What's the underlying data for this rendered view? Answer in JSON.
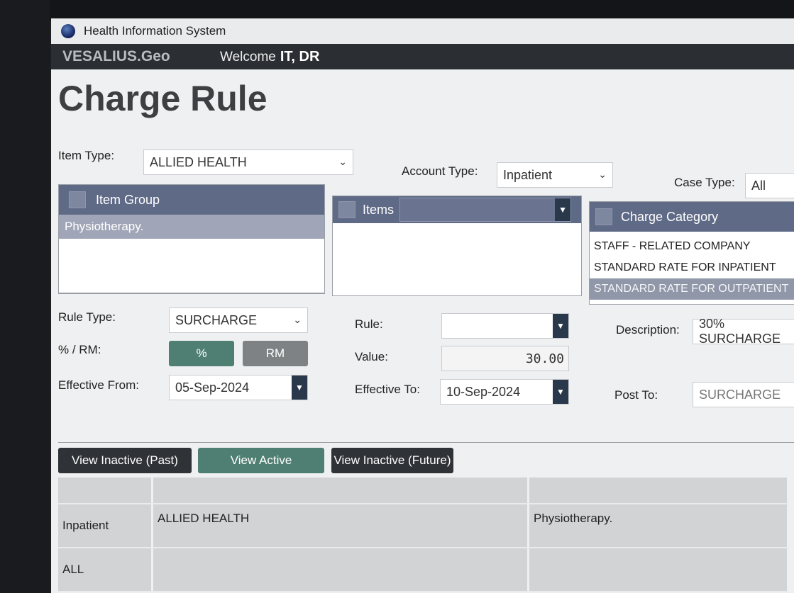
{
  "window": {
    "title": "Health Information System"
  },
  "appbar": {
    "brand": "VESALIUS.Geo",
    "welcome_label": "Welcome",
    "user": "IT, DR"
  },
  "page": {
    "title": "Charge Rule"
  },
  "filters": {
    "item_type_label": "Item Type:",
    "item_type_value": "ALLIED HEALTH",
    "account_type_label": "Account Type:",
    "account_type_value": "Inpatient",
    "case_type_label": "Case Type:",
    "case_type_value": "All"
  },
  "item_group": {
    "header": "Item Group",
    "rows": [
      "Physiotherapy."
    ]
  },
  "items": {
    "header": "Items",
    "filter_value": ""
  },
  "charge_category": {
    "header": "Charge Category",
    "rows": [
      "STAFF - RELATED COMPANY",
      "STANDARD RATE FOR INPATIENT",
      "STANDARD RATE FOR OUTPATIENT"
    ],
    "selected_index": 2
  },
  "form": {
    "rule_type_label": "Rule Type:",
    "rule_type_value": "SURCHARGE",
    "rule_label": "Rule:",
    "rule_value": "",
    "description_label": "Description:",
    "description_value": "30% SURCHARGE",
    "pct_rm_label": "% / RM:",
    "pct_button": "%",
    "rm_button": "RM",
    "value_label": "Value:",
    "value_value": "30.00",
    "effective_from_label": "Effective From:",
    "effective_from_value": "05-Sep-2024",
    "effective_to_label": "Effective To:",
    "effective_to_value": "10-Sep-2024",
    "post_to_label": "Post To:",
    "post_to_value": "SURCHARGE"
  },
  "view_buttons": {
    "inactive_past": "View Inactive (Past)",
    "active": "View Active",
    "inactive_future": "View Inactive (Future)"
  },
  "grid": {
    "rows": [
      [
        "",
        "",
        ""
      ],
      [
        "Inpatient",
        "ALLIED HEALTH",
        "Physiotherapy."
      ],
      [
        "ALL",
        "",
        ""
      ]
    ]
  },
  "colors": {
    "panel_header": "#5f6a86",
    "active_button": "#4f7f73",
    "dark_button": "#2f3236",
    "dropdown_button": "#29384a"
  }
}
